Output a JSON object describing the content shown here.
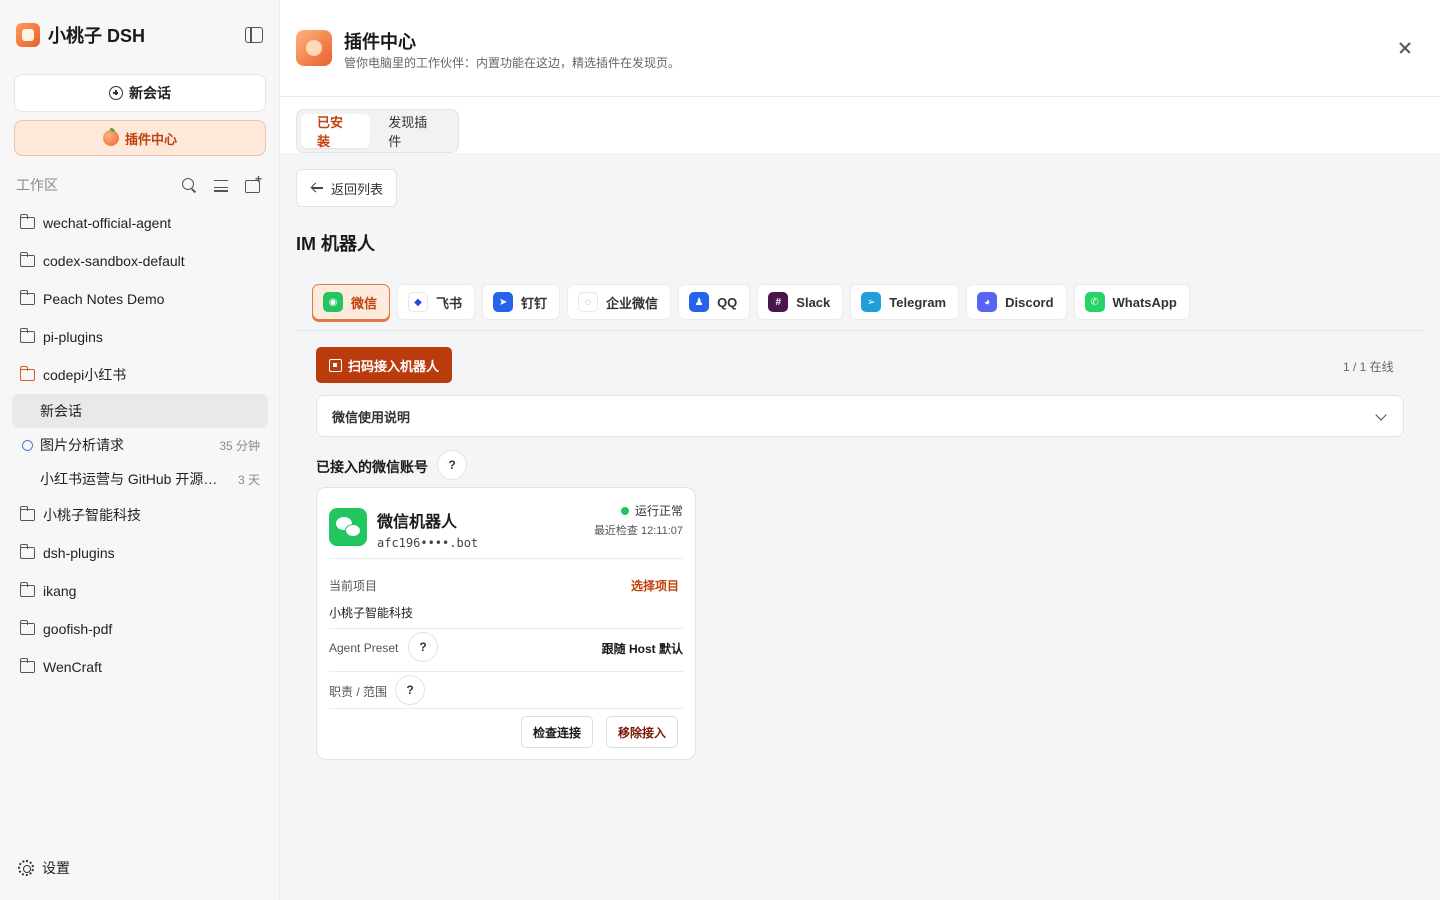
{
  "app": {
    "name": "小桃子 DSH",
    "new_chat_label": "新会话",
    "plugin_center_label": "插件中心",
    "workspace_label": "工作区",
    "settings_label": "设置"
  },
  "sidebar": {
    "folders": [
      {
        "label": "wechat-official-agent"
      },
      {
        "label": "codex-sandbox-default"
      },
      {
        "label": "Peach Notes Demo"
      },
      {
        "label": "pi-plugins"
      },
      {
        "label": "codepi小红书"
      },
      {
        "label": "小桃子智能科技"
      },
      {
        "label": "dsh-plugins"
      },
      {
        "label": "ikang"
      },
      {
        "label": "goofish-pdf"
      },
      {
        "label": "WenCraft"
      }
    ],
    "sessions": [
      {
        "label": "新会话",
        "time": ""
      },
      {
        "label": "图片分析请求",
        "time": "35 分钟"
      },
      {
        "label": "小红书运营与 GitHub 开源项目",
        "time": "3 天"
      }
    ]
  },
  "header": {
    "title": "插件中心",
    "subtitle": "管你电脑里的工作伙伴：内置功能在这边，精选插件在发现页。"
  },
  "tabs": [
    {
      "label": "已安装"
    },
    {
      "label": "发现插件"
    }
  ],
  "back_label": "返回列表",
  "section_title": "IM 机器人",
  "im_tabs": [
    {
      "label": "微信",
      "color": "#22c55e"
    },
    {
      "label": "飞书",
      "color": "#1d4ed8"
    },
    {
      "label": "钉钉",
      "color": "#2563eb"
    },
    {
      "label": "企业微信",
      "color": "#3b82f6"
    },
    {
      "label": "QQ",
      "color": "#2563eb"
    },
    {
      "label": "Slack",
      "color": "#4a154b"
    },
    {
      "label": "Telegram",
      "color": "#229ed9"
    },
    {
      "label": "Discord",
      "color": "#5865f2"
    },
    {
      "label": "WhatsApp",
      "color": "#25d366"
    }
  ],
  "scan_label": "扫码接入机器人",
  "online_status": "1 / 1 在线",
  "guide_label": "微信使用说明",
  "accounts_title": "已接入的微信账号",
  "help_mark": "?",
  "card": {
    "name": "微信机器人",
    "id": "afc196••••.bot",
    "status": "运行正常",
    "last_check": "最近检查 12:11:07",
    "project_label": "当前项目",
    "project_action": "选择项目",
    "project_value": "小桃子智能科技",
    "preset_label": "Agent Preset",
    "preset_value": "跟随 Host 默认",
    "scope_label": "职责 / 范围",
    "check_label": "检查连接",
    "remove_label": "移除接入"
  }
}
